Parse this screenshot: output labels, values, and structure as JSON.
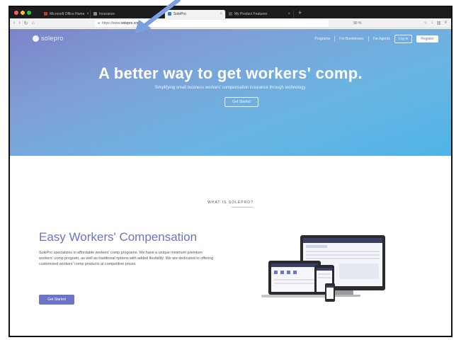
{
  "browser": {
    "tabs": [
      {
        "label": "Microsoft Office Home",
        "active": false
      },
      {
        "label": "Insurance",
        "active": false
      },
      {
        "label": "SolePro",
        "active": true
      },
      {
        "label": "My Product Features",
        "active": false
      }
    ],
    "url": {
      "prefix": "https://www.",
      "host": "solepro.com"
    },
    "zoom": "90 %"
  },
  "site": {
    "logo_text": "solepro",
    "nav": {
      "programs": "Programs",
      "for_businesses": "For Businesses",
      "for_agents": "For Agents",
      "login": "Log in",
      "register": "Register"
    },
    "hero": {
      "title": "A better way to get workers' comp.",
      "subtitle": "Simplifying small business workers' compensation insurance through technology.",
      "cta": "Get Started"
    },
    "section_label": "WHAT IS SOLEPRO?",
    "feature": {
      "title": "Easy Workers' Compensation",
      "body": "SolePro specializes in affordable workers' comp programs. We have a unique minimum premium workers' comp program, as well as traditional options with added flexibility. We are dedicated to offering customized workers' comp products at competitive prices.",
      "cta": "Get Started"
    }
  },
  "colors": {
    "brand": "#6b74c6",
    "hero_start": "#7b84c8",
    "hero_end": "#4fb4e7",
    "arrow": "#7a9ee0"
  },
  "icons": [
    "back-icon",
    "forward-icon",
    "lock-icon",
    "star-icon",
    "download-icon",
    "menu-icon",
    "arrow-pointer-icon"
  ]
}
